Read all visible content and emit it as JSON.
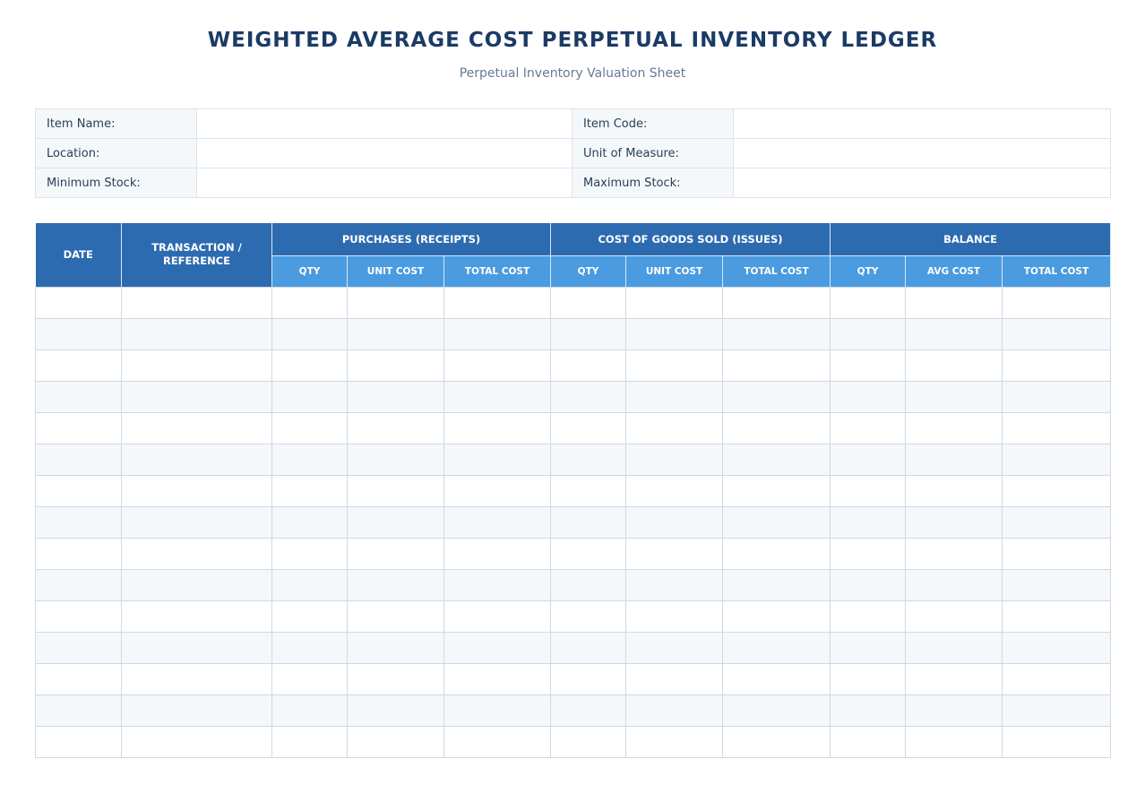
{
  "header": {
    "title": "WEIGHTED AVERAGE COST PERPETUAL INVENTORY LEDGER",
    "subtitle": "Perpetual Inventory Valuation Sheet"
  },
  "info_fields": [
    {
      "left_label": "Item Name:",
      "left_value": "",
      "right_label": "Item Code:",
      "right_value": ""
    },
    {
      "left_label": "Location:",
      "left_value": "",
      "right_label": "Unit of Measure:",
      "right_value": ""
    },
    {
      "left_label": "Minimum Stock:",
      "left_value": "",
      "right_label": "Maximum Stock:",
      "right_value": ""
    }
  ],
  "ledger": {
    "date_header": "DATE",
    "transaction_header": "TRANSACTION / REFERENCE",
    "groups": [
      {
        "label": "PURCHASES (RECEIPTS)",
        "columns": [
          "QTY",
          "UNIT COST",
          "TOTAL COST"
        ]
      },
      {
        "label": "COST OF GOODS SOLD (ISSUES)",
        "columns": [
          "QTY",
          "UNIT COST",
          "TOTAL COST"
        ]
      },
      {
        "label": "BALANCE",
        "columns": [
          "QTY",
          "AVG COST",
          "TOTAL COST"
        ]
      }
    ],
    "rows": [
      [
        "",
        "",
        "",
        "",
        "",
        "",
        "",
        "",
        "",
        "",
        ""
      ],
      [
        "",
        "",
        "",
        "",
        "",
        "",
        "",
        "",
        "",
        "",
        ""
      ],
      [
        "",
        "",
        "",
        "",
        "",
        "",
        "",
        "",
        "",
        "",
        ""
      ],
      [
        "",
        "",
        "",
        "",
        "",
        "",
        "",
        "",
        "",
        "",
        ""
      ],
      [
        "",
        "",
        "",
        "",
        "",
        "",
        "",
        "",
        "",
        "",
        ""
      ],
      [
        "",
        "",
        "",
        "",
        "",
        "",
        "",
        "",
        "",
        "",
        ""
      ],
      [
        "",
        "",
        "",
        "",
        "",
        "",
        "",
        "",
        "",
        "",
        ""
      ],
      [
        "",
        "",
        "",
        "",
        "",
        "",
        "",
        "",
        "",
        "",
        ""
      ],
      [
        "",
        "",
        "",
        "",
        "",
        "",
        "",
        "",
        "",
        "",
        ""
      ],
      [
        "",
        "",
        "",
        "",
        "",
        "",
        "",
        "",
        "",
        "",
        ""
      ],
      [
        "",
        "",
        "",
        "",
        "",
        "",
        "",
        "",
        "",
        "",
        ""
      ],
      [
        "",
        "",
        "",
        "",
        "",
        "",
        "",
        "",
        "",
        "",
        ""
      ],
      [
        "",
        "",
        "",
        "",
        "",
        "",
        "",
        "",
        "",
        "",
        ""
      ],
      [
        "",
        "",
        "",
        "",
        "",
        "",
        "",
        "",
        "",
        "",
        ""
      ],
      [
        "",
        "",
        "",
        "",
        "",
        "",
        "",
        "",
        "",
        "",
        ""
      ]
    ]
  }
}
